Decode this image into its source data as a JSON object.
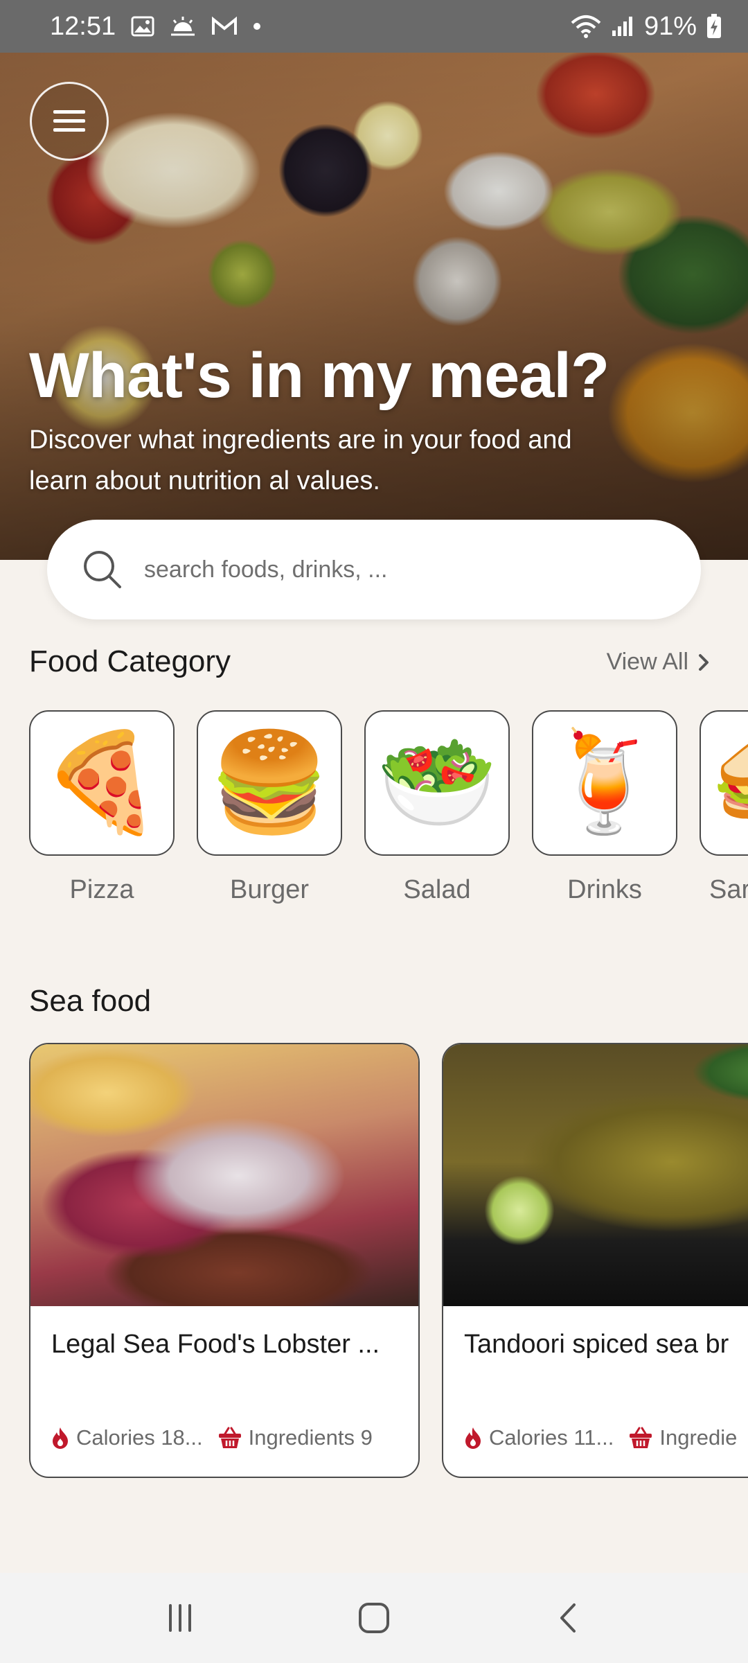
{
  "status_bar": {
    "time": "12:51",
    "battery": "91%",
    "icons": [
      "gallery-icon",
      "weather-icon",
      "gmail-icon",
      "dot-icon",
      "wifi-icon",
      "signal-icon",
      "battery-charging-icon"
    ]
  },
  "hero": {
    "title": "What's in my meal?",
    "subtitle": "Discover what ingredients are in your food and learn about nutrition al values.",
    "menu_icon": "hamburger-menu-icon"
  },
  "search": {
    "placeholder": "search foods, drinks, ..."
  },
  "food_category": {
    "title": "Food Category",
    "view_all": "View All",
    "items": [
      {
        "label": "Pizza",
        "emoji": "🍕"
      },
      {
        "label": "Burger",
        "emoji": "🍔"
      },
      {
        "label": "Salad",
        "emoji": "🥗"
      },
      {
        "label": "Drinks",
        "emoji": "🍹"
      },
      {
        "label": "Sar",
        "emoji": "🥪"
      }
    ]
  },
  "sea_food": {
    "title": "Sea food",
    "cards": [
      {
        "title": "Legal Sea Food's Lobster ...",
        "calories": "Calories 18...",
        "ingredients": "Ingredients 9"
      },
      {
        "title": "Tandoori spiced sea br",
        "calories": "Calories 11...",
        "ingredients": "Ingredie"
      }
    ]
  },
  "colors": {
    "background": "#f6f2ed",
    "accent_red": "#c0192c",
    "status_bar": "#6a6a6a"
  }
}
